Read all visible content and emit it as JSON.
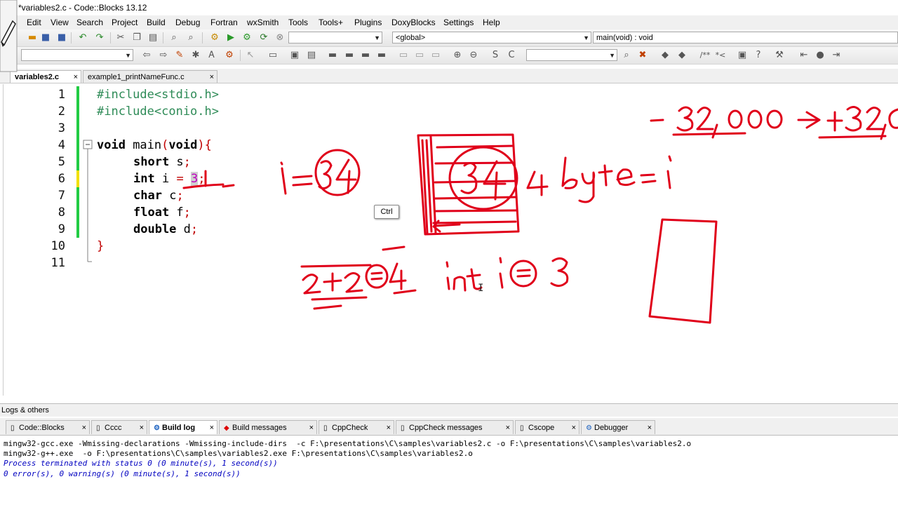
{
  "window": {
    "title": "*variables2.c - Code::Blocks 13.12"
  },
  "menu": [
    "Edit",
    "View",
    "Search",
    "Project",
    "Build",
    "Debug",
    "Fortran",
    "wxSmith",
    "Tools",
    "Tools+",
    "Plugins",
    "DoxyBlocks",
    "Settings",
    "Help"
  ],
  "toolbar": {
    "target_combo": "",
    "scope_combo": "<global>",
    "function_combo": "main(void) : void",
    "search_combo": "",
    "regex_combo": ""
  },
  "editor_tabs": [
    {
      "label": "variables2.c",
      "close": "×",
      "active": true
    },
    {
      "label": "example1_printNameFunc.c",
      "close": "×",
      "active": false
    }
  ],
  "code": {
    "line_numbers": [
      "1",
      "2",
      "3",
      "4",
      "5",
      "6",
      "7",
      "8",
      "9",
      "10",
      "11"
    ],
    "line1": "#include<stdio.h>",
    "line2": "#include<conio.h>",
    "l4_kw1": "void",
    "l4_mid": " main",
    "l4_p1": "(",
    "l4_kw2": "void",
    "l4_p2": "){",
    "l5_kw": "short",
    "l5_rest": " s",
    "l5_semi": ";",
    "l6_kw": "int",
    "l6_rest": " i ",
    "l6_eq": "=",
    "l6_sp": " ",
    "l6_num": "3",
    "l6_semi": ";",
    "l7_kw": "char",
    "l7_rest": " c",
    "l7_semi": ";",
    "l8_kw": "float",
    "l8_rest": " f",
    "l8_semi": ";",
    "l9_kw": "double",
    "l9_rest": " d",
    "l9_semi": ";",
    "l10": "}"
  },
  "tooltip": "Ctrl",
  "logs": {
    "title": "Logs & others",
    "tabs": [
      {
        "label": "Code::Blocks",
        "icon": "doc-icon",
        "close": "×",
        "active": false
      },
      {
        "label": "Cccc",
        "icon": "doc-icon",
        "close": "×",
        "active": false
      },
      {
        "label": "Build log",
        "icon": "gear-icon",
        "close": "×",
        "active": true
      },
      {
        "label": "Build messages",
        "icon": "pin-icon",
        "close": "×",
        "active": false
      },
      {
        "label": "CppCheck",
        "icon": "doc-icon",
        "close": "×",
        "active": false
      },
      {
        "label": "CppCheck messages",
        "icon": "doc-icon",
        "close": "×",
        "active": false
      },
      {
        "label": "Cscope",
        "icon": "doc-icon",
        "close": "×",
        "active": false
      },
      {
        "label": "Debugger",
        "icon": "gear-icon",
        "close": "×",
        "active": false
      }
    ],
    "lines": [
      "mingw32-gcc.exe -Wmissing-declarations -Wmissing-include-dirs  -c F:\\presentations\\C\\samples\\variables2.c -o F:\\presentations\\C\\samples\\variables2.o",
      "mingw32-g++.exe  -o F:\\presentations\\C\\samples\\variables2.exe F:\\presentations\\C\\samples\\variables2.o",
      "Process terminated with status 0 (0 minute(s), 1 second(s))",
      "0 error(s), 0 warning(s) (0 minute(s), 1 second(s))"
    ]
  },
  "colors": {
    "ink": "#e0001a",
    "log_status": "#0000c0",
    "preprocessor": "#2e8b57",
    "change_bar": "#22cc44",
    "change_bar_unsaved": "#f2e000"
  }
}
